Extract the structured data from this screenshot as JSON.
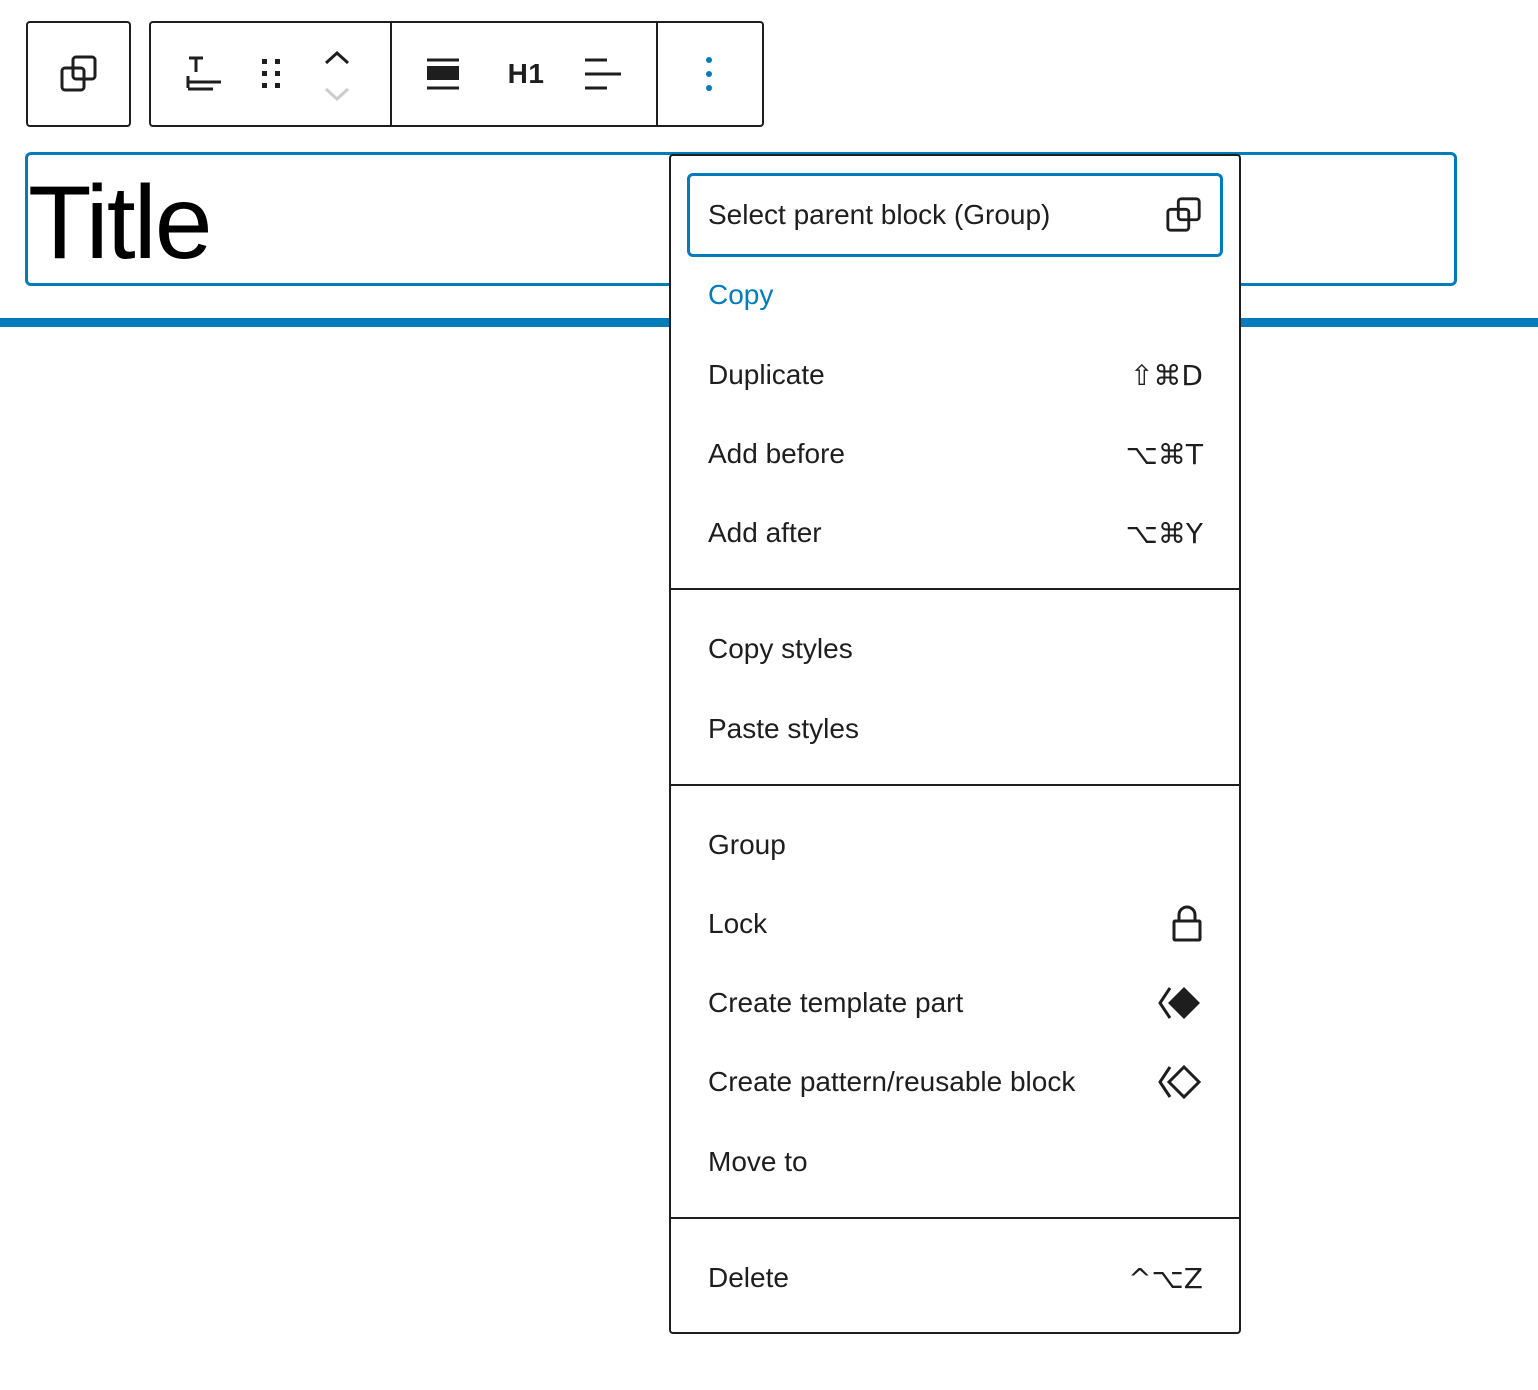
{
  "toolbar": {
    "parent_button_icon": "select-parent-icon",
    "buttons": [
      {
        "name": "block-type-icon"
      },
      {
        "name": "drag-handle-icon"
      },
      {
        "name": "move-up-icon"
      },
      {
        "name": "move-down-icon"
      },
      {
        "name": "align-icon"
      },
      {
        "name": "heading-level"
      },
      {
        "name": "text-align-icon"
      },
      {
        "name": "options-icon"
      }
    ],
    "heading_level_label": "H1"
  },
  "editor": {
    "title_text": "Title"
  },
  "menu": {
    "items": [
      {
        "label": "Select parent block (Group)",
        "icon": "select-parent-icon",
        "shortcut": ""
      },
      {
        "label": "Copy",
        "shortcut": ""
      },
      {
        "label": "Duplicate",
        "shortcut": "⇧⌘D"
      },
      {
        "label": "Add before",
        "shortcut": "⌥⌘T"
      },
      {
        "label": "Add after",
        "shortcut": "⌥⌘Y"
      },
      {
        "label": "Copy styles",
        "shortcut": ""
      },
      {
        "label": "Paste styles",
        "shortcut": ""
      },
      {
        "label": "Group",
        "shortcut": ""
      },
      {
        "label": "Lock",
        "icon": "lock-icon",
        "shortcut": ""
      },
      {
        "label": "Create template part",
        "icon": "template-part-icon",
        "shortcut": ""
      },
      {
        "label": "Create pattern/reusable block",
        "icon": "reusable-block-icon",
        "shortcut": ""
      },
      {
        "label": "Move to",
        "shortcut": ""
      },
      {
        "label": "Delete",
        "shortcut": "^⌥Z"
      }
    ]
  },
  "colors": {
    "accent": "#007cba",
    "text": "#1e1e1e",
    "muted_icon": "#cccccc"
  }
}
